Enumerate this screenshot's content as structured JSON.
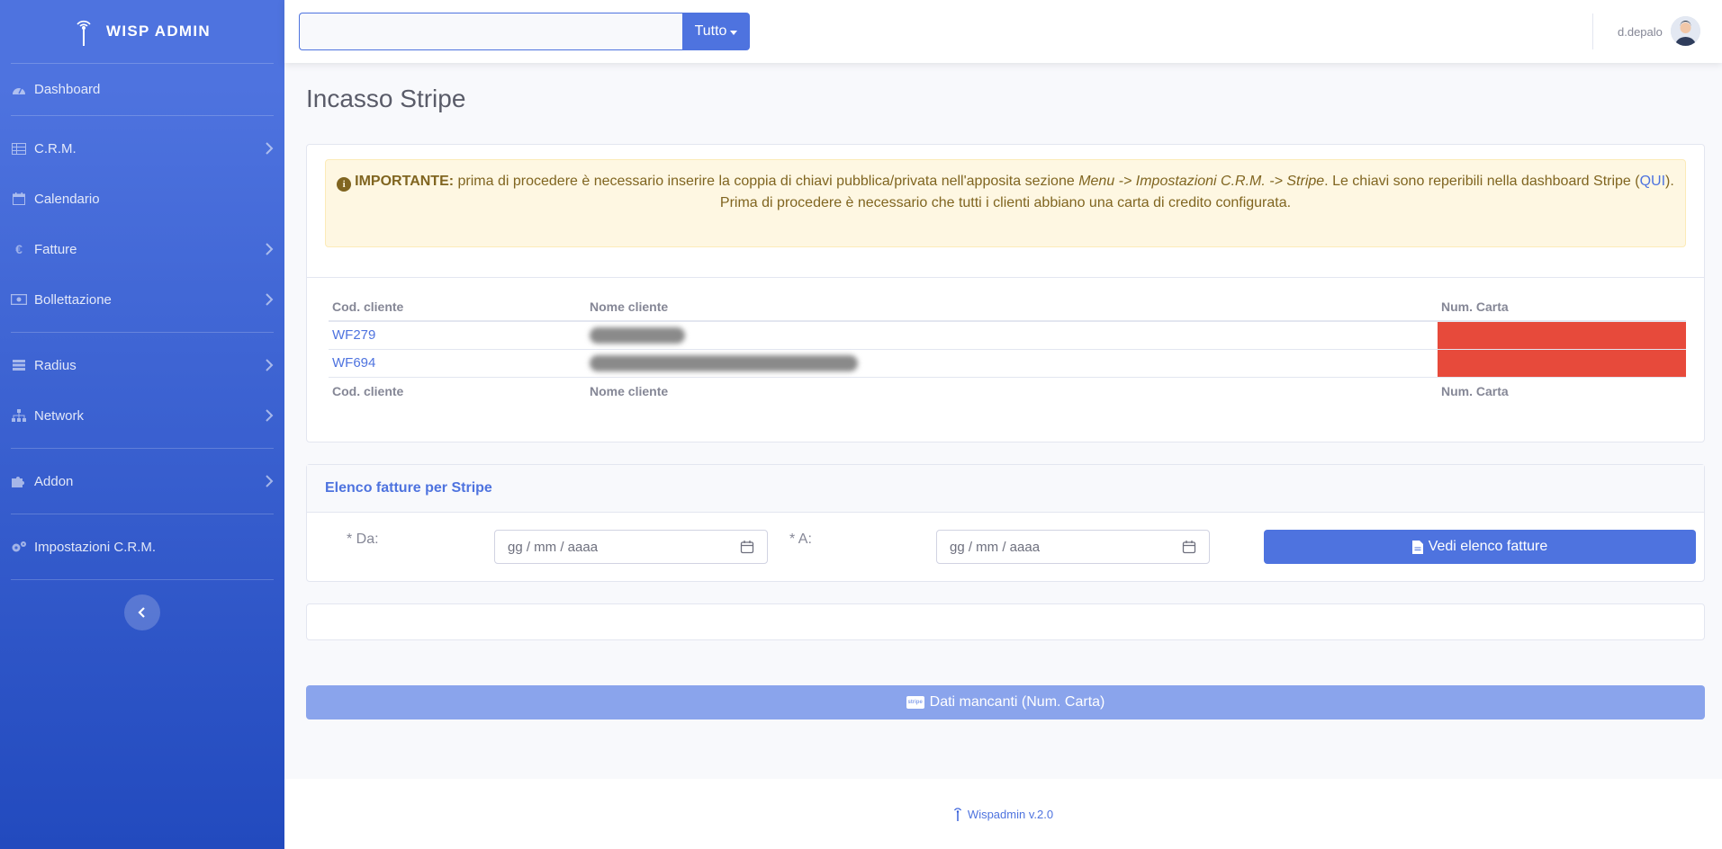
{
  "app": {
    "brand": "WISP ADMIN",
    "version_label": "Wispadmin v.2.0"
  },
  "sidebar": {
    "items": [
      {
        "label": "Dashboard",
        "icon": "tachometer-icon"
      },
      {
        "label": "C.R.M.",
        "icon": "table-icon"
      },
      {
        "label": "Calendario",
        "icon": "calendar-icon"
      },
      {
        "label": "Fatture",
        "icon": "euro-icon"
      },
      {
        "label": "Bollettazione",
        "icon": "money-bill-icon"
      },
      {
        "label": "Radius",
        "icon": "list-icon"
      },
      {
        "label": "Network",
        "icon": "sitemap-icon"
      },
      {
        "label": "Addon",
        "icon": "puzzle-icon"
      },
      {
        "label": "Impostazioni C.R.M.",
        "icon": "cogs-icon"
      }
    ]
  },
  "topbar": {
    "search": {
      "value": "",
      "placeholder": ""
    },
    "filter_label": "Tutto",
    "user_name": "d.depalo"
  },
  "page": {
    "title": "Incasso Stripe"
  },
  "alert": {
    "strong": "IMPORTANTE:",
    "text1": " prima di procedere è necessario inserire la coppia di chiavi pubblica/privata nell'apposita sezione ",
    "menu_path": "Menu -> Impostazioni C.R.M. -> Stripe",
    "text2": ". Le chiavi sono reperibili nella dashboard Stripe (",
    "link": "QUI",
    "text3": ").",
    "line2": "Prima di procedere è necessario che tutti i clienti abbiano una carta di credito configurata."
  },
  "table": {
    "headers": {
      "cod": "Cod. cliente",
      "nome": "Nome cliente",
      "carta": "Num. Carta"
    },
    "rows": [
      {
        "cod": "WF279",
        "nome": ""
      },
      {
        "cod": "WF694",
        "nome": ""
      }
    ]
  },
  "invoices": {
    "header": "Elenco fatture per Stripe",
    "from_label": "* Da:",
    "to_label": "* A:",
    "from_placeholder": "gg / mm / aaaa",
    "to_placeholder": "gg / mm / aaaa",
    "button": "Vedi elenco fatture"
  },
  "missing_button": "Dati mancanti (Num. Carta)",
  "colors": {
    "primary": "#4e73df",
    "danger": "#e74a3b",
    "warning_bg": "#fef7e2"
  }
}
